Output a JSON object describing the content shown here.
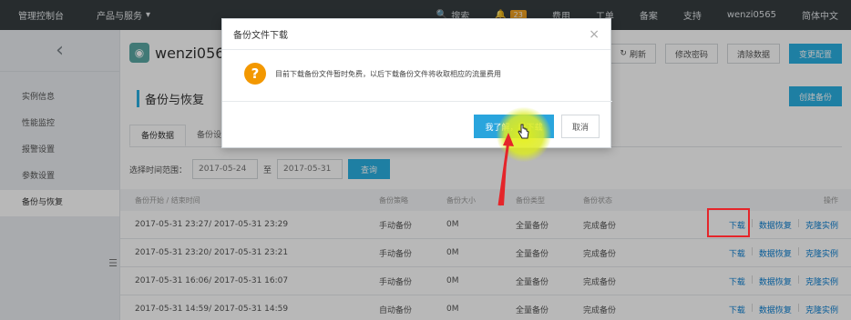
{
  "topbar": {
    "brand": "管理控制台",
    "products": "产品与服务",
    "search": "搜索",
    "bell_count": "23",
    "items": [
      "费用",
      "工单",
      "备案",
      "支持",
      "wenzi0565",
      "简体中文"
    ]
  },
  "sidebar": {
    "back_glyph": "‹",
    "items": [
      {
        "label": "实例信息"
      },
      {
        "label": "性能监控"
      },
      {
        "label": "报警设置"
      },
      {
        "label": "参数设置"
      },
      {
        "label": "备份与恢复"
      }
    ],
    "collapse_glyph": "☰"
  },
  "main": {
    "instance_name": "wenzi0565",
    "buttons": {
      "refresh": "刷新",
      "change_password": "修改密码",
      "clear_data": "清除数据",
      "change_config": "变更配置",
      "create_backup": "创建备份"
    },
    "section_title": "备份与恢复",
    "tabs": [
      "备份数据",
      "备份设置"
    ],
    "filter": {
      "label": "选择时间范围：",
      "from": "2017-05-24",
      "to_sep": "至",
      "to": "2017-05-31",
      "query": "查询"
    },
    "table": {
      "headers": [
        "备份开始 / 结束时间",
        "备份策略",
        "备份大小",
        "备份类型",
        "备份状态",
        "操作"
      ],
      "rows": [
        {
          "time": "2017-05-31 23:27/ 2017-05-31 23:29",
          "policy": "手动备份",
          "size": "0M",
          "type": "全量备份",
          "status": "完成备份"
        },
        {
          "time": "2017-05-31 23:20/ 2017-05-31 23:21",
          "policy": "手动备份",
          "size": "0M",
          "type": "全量备份",
          "status": "完成备份"
        },
        {
          "time": "2017-05-31 16:06/ 2017-05-31 16:07",
          "policy": "手动备份",
          "size": "0M",
          "type": "全量备份",
          "status": "完成备份"
        },
        {
          "time": "2017-05-31 14:59/ 2017-05-31 14:59",
          "policy": "自动备份",
          "size": "0M",
          "type": "全量备份",
          "status": "完成备份"
        }
      ],
      "actions": {
        "download": "下载",
        "restore": "数据恢复",
        "clone": "克隆实例",
        "sep": "|"
      }
    }
  },
  "dialog": {
    "title": "备份文件下载",
    "close_glyph": "×",
    "icon_glyph": "?",
    "message": "目前下载备份文件暂时免费，以后下载备份文件将收取相应的流量费用",
    "ok": "我了解，我下载",
    "cancel": "取消"
  },
  "colors": {
    "accent": "#2ab0e2",
    "topbar": "#373d41",
    "link": "#0a7fd2",
    "warning": "#f39800",
    "highlight": "#e5252a"
  }
}
